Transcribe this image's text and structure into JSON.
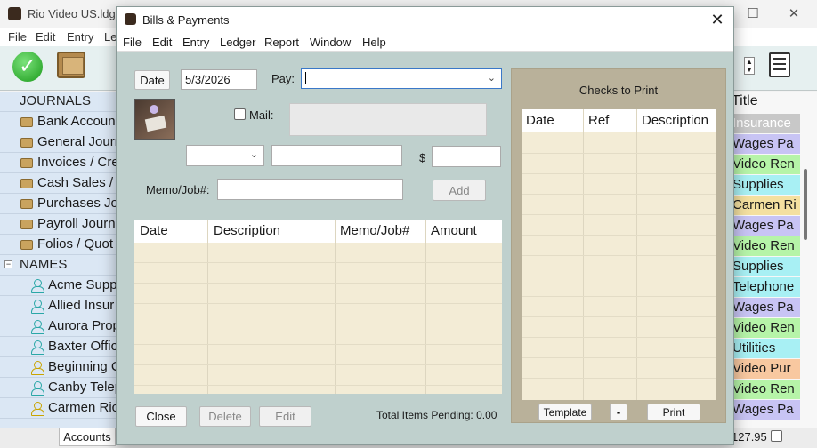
{
  "bg_window": {
    "title": "Rio Video US.ldg",
    "menu": [
      "File",
      "Edit",
      "Entry",
      "Le"
    ],
    "tree": {
      "journals_header": "JOURNALS",
      "journals": [
        "Bank Accoun",
        "General Journ",
        "Invoices / Cre",
        "Cash Sales / ",
        "Purchases Jou",
        "Payroll Journ",
        "Folios / Quot"
      ],
      "names_header": "NAMES",
      "names": [
        {
          "label": "Acme Supp",
          "color": "teal"
        },
        {
          "label": "Allied Insur",
          "color": "teal"
        },
        {
          "label": "Aurora Prop",
          "color": "teal"
        },
        {
          "label": "Baxter Offic",
          "color": "teal"
        },
        {
          "label": "Beginning C",
          "color": "yellow"
        },
        {
          "label": "Canby Telep",
          "color": "teal"
        },
        {
          "label": "Carmen Ric",
          "color": "yellow"
        }
      ]
    },
    "accounts_tab": "Accounts",
    "right_header": "Title",
    "right_rows": [
      {
        "text": "Insurance",
        "color": "#c8c8c8",
        "fg": "#ffffff"
      },
      {
        "text": "Wages Pa",
        "color": "#c8c4f4",
        "fg": "#1a1a1a"
      },
      {
        "text": "Video Ren",
        "color": "#b6f4a8",
        "fg": "#1a1a1a"
      },
      {
        "text": "Supplies",
        "color": "#a8f0f4",
        "fg": "#1a1a1a"
      },
      {
        "text": "Carmen Ri",
        "color": "#f4e0a0",
        "fg": "#1a1a1a"
      },
      {
        "text": "Wages Pa",
        "color": "#c8c4f4",
        "fg": "#1a1a1a"
      },
      {
        "text": "Video Ren",
        "color": "#b6f4a8",
        "fg": "#1a1a1a"
      },
      {
        "text": "Supplies",
        "color": "#a8f0f4",
        "fg": "#1a1a1a"
      },
      {
        "text": "Telephone",
        "color": "#a8f0f4",
        "fg": "#1a1a1a"
      },
      {
        "text": "Wages Pa",
        "color": "#c8c4f4",
        "fg": "#1a1a1a"
      },
      {
        "text": "Video Ren",
        "color": "#b6f4a8",
        "fg": "#1a1a1a"
      },
      {
        "text": "Utilities",
        "color": "#a8f0f4",
        "fg": "#1a1a1a"
      },
      {
        "text": "Video Pur",
        "color": "#f8c8a0",
        "fg": "#1a1a1a"
      },
      {
        "text": "Video Ren",
        "color": "#b6f4a8",
        "fg": "#1a1a1a"
      },
      {
        "text": "Wages Pa",
        "color": "#c8c4f4",
        "fg": "#1a1a1a"
      }
    ],
    "status_total": "127.95"
  },
  "dialog": {
    "title": "Bills & Payments",
    "close_glyph": "✕",
    "menu": [
      "File",
      "Edit",
      "Entry",
      "Ledger",
      "Report",
      "Window",
      "Help"
    ],
    "date_button": "Date",
    "date_value": "5/3/2026",
    "pay_label": "Pay:",
    "pay_value": "",
    "mail_label": "Mail:",
    "dollar": "$",
    "memo_label": "Memo/Job#:",
    "add_button": "Add",
    "grid_headers": [
      "Date",
      "Description",
      "Memo/Job#",
      "Amount"
    ],
    "close_button": "Close",
    "delete_button": "Delete",
    "edit_button": "Edit",
    "total_pending_label": "Total Items Pending:",
    "total_pending_value": "0.00",
    "checks": {
      "title": "Checks to Print",
      "headers": [
        "Date",
        "Ref",
        "Description"
      ],
      "template_button": "Template",
      "minus_button": "-",
      "print_button": "Print"
    }
  }
}
